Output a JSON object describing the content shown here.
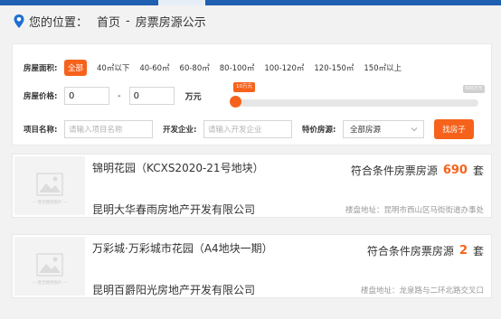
{
  "breadcrumb": {
    "location_label": "您的位置：",
    "home": "首页",
    "separator": "-",
    "current": "房票房源公示"
  },
  "filters": {
    "area": {
      "label": "房屋面积:",
      "options": [
        {
          "label": "全部",
          "active": true
        },
        {
          "label": "40㎡以下",
          "active": false
        },
        {
          "label": "40-60㎡",
          "active": false
        },
        {
          "label": "60-80㎡",
          "active": false
        },
        {
          "label": "80-100㎡",
          "active": false
        },
        {
          "label": "100-120㎡",
          "active": false
        },
        {
          "label": "120-150㎡",
          "active": false
        },
        {
          "label": "150㎡以上",
          "active": false
        }
      ]
    },
    "price": {
      "label": "房屋价格:",
      "min_value": "0",
      "max_value": "0",
      "dash": "-",
      "unit": "万元",
      "slider_min_tip": "10万元",
      "slider_max_tip": "500万元",
      "slider_level": 0
    },
    "project": {
      "label": "项目名称:",
      "placeholder": "请输入项目名称"
    },
    "developer": {
      "label": "开发企业:",
      "placeholder": "请输入开发企业"
    },
    "special": {
      "label": "特价房源:",
      "selected": "全部房源"
    },
    "search_button": "找房子"
  },
  "listings": [
    {
      "title": "锦明花园（KCXS2020-21号地块）",
      "developer": "昆明大华春雨房地产开发有限公司",
      "count_label": "符合条件房票房源",
      "count": "690",
      "count_unit": "套",
      "address": "楼盘地址：昆明市西山区马街街道办事处",
      "thumb_caption": "— 暂无楼盘图片 —"
    },
    {
      "title": "万彩城·万彩城市花园（A4地块一期）",
      "developer": "昆明百爵阳光房地产开发有限公司",
      "count_label": "符合条件房票房源",
      "count": "2",
      "count_unit": "套",
      "address": "楼盘地址：龙泉路与二环北路交叉口",
      "thumb_caption": "— 暂无楼盘图片 —"
    }
  ],
  "colors": {
    "accent": "#f6621b",
    "brand_blue": "#1f5fb0"
  }
}
